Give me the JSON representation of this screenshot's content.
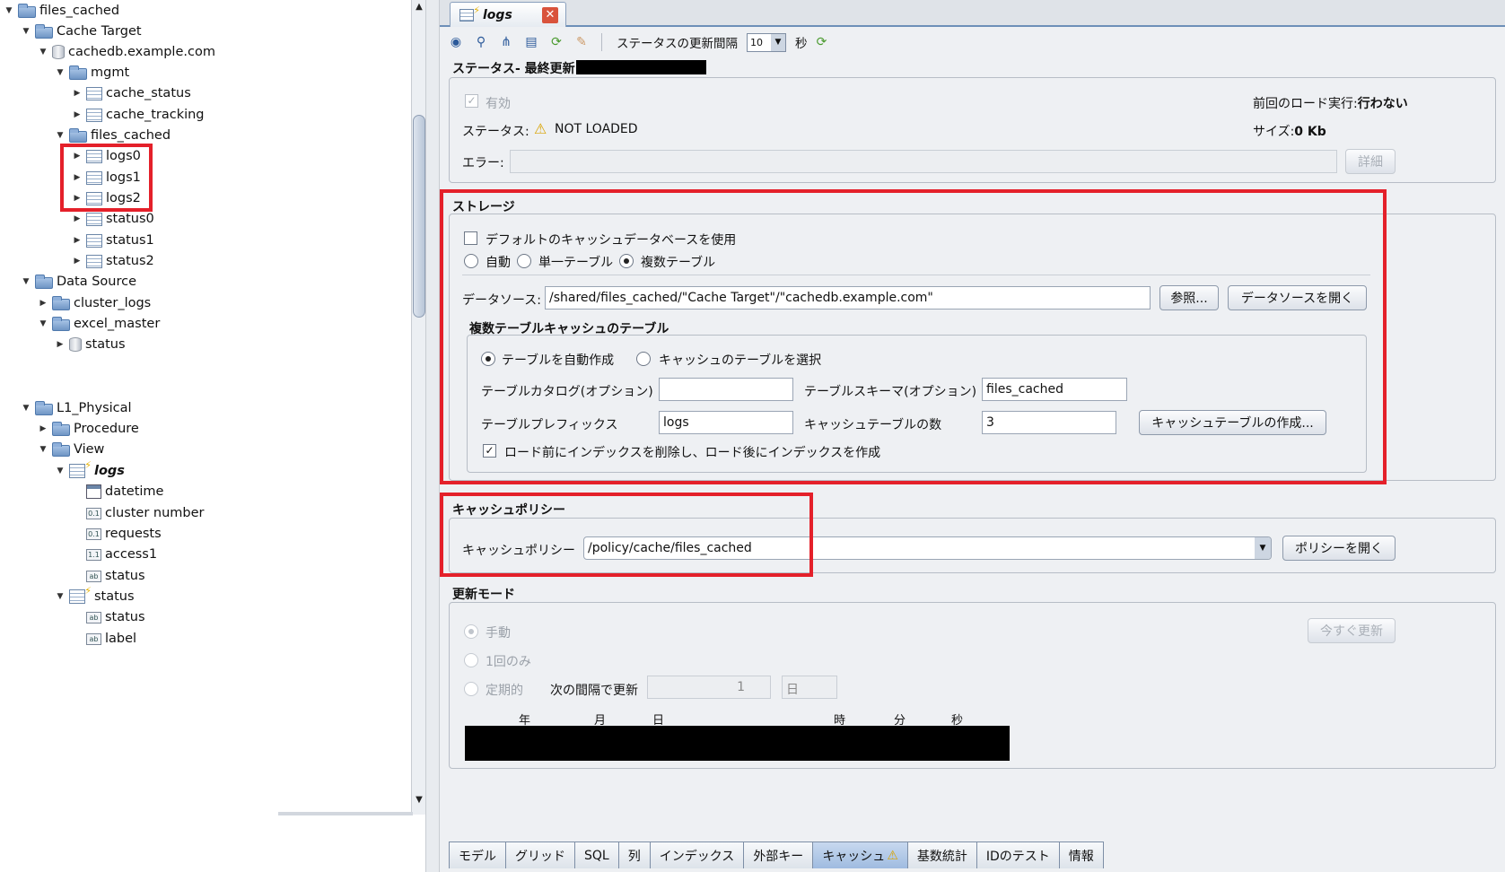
{
  "tree": {
    "items": [
      {
        "label": "files_cached",
        "expanded": true,
        "icon": "folder-icon"
      },
      {
        "label": "Cache Target",
        "expanded": true,
        "icon": "folder-icon"
      },
      {
        "label": "cachedb.example.com",
        "expanded": true,
        "icon": "database-icon"
      },
      {
        "label": "mgmt",
        "expanded": true,
        "icon": "folder-icon"
      },
      {
        "label": "cache_status",
        "expanded": false,
        "icon": "table-icon"
      },
      {
        "label": "cache_tracking",
        "expanded": false,
        "icon": "table-icon"
      },
      {
        "label": "files_cached",
        "expanded": true,
        "icon": "folder-icon"
      },
      {
        "label": "logs0",
        "expanded": false,
        "icon": "table-icon"
      },
      {
        "label": "logs1",
        "expanded": false,
        "icon": "table-icon"
      },
      {
        "label": "logs2",
        "expanded": false,
        "icon": "table-icon"
      },
      {
        "label": "status0",
        "expanded": false,
        "icon": "table-icon"
      },
      {
        "label": "status1",
        "expanded": false,
        "icon": "table-icon"
      },
      {
        "label": "status2",
        "expanded": false,
        "icon": "table-icon"
      },
      {
        "label": "Data Source",
        "expanded": true,
        "icon": "folder-icon"
      },
      {
        "label": "cluster_logs",
        "expanded": false,
        "icon": "folder-icon"
      },
      {
        "label": "excel_master",
        "expanded": true,
        "icon": "folder-icon"
      },
      {
        "label": "status",
        "expanded": false,
        "icon": "database-icon"
      },
      {
        "label": "L1_Physical",
        "expanded": true,
        "icon": "folder-icon"
      },
      {
        "label": "Procedure",
        "expanded": false,
        "icon": "folder-icon"
      },
      {
        "label": "View",
        "expanded": true,
        "icon": "folder-icon"
      },
      {
        "label": "logs",
        "expanded": true,
        "icon": "view-icon"
      },
      {
        "label": "datetime",
        "icon": "calendar-column-icon"
      },
      {
        "label": "cluster number",
        "icon": "column-icon"
      },
      {
        "label": "requests",
        "icon": "column-icon"
      },
      {
        "label": "access1",
        "icon": "column-icon"
      },
      {
        "label": "status",
        "icon": "column-icon"
      },
      {
        "label": "status",
        "expanded": true,
        "icon": "view-icon"
      },
      {
        "label": "status",
        "icon": "column-icon"
      },
      {
        "label": "label",
        "icon": "column-icon"
      }
    ]
  },
  "editor": {
    "tab_title": "logs",
    "tab_close": "✕",
    "toolbar": {
      "refresh_interval_label": "ステータスの更新間隔",
      "refresh_interval_value": "10",
      "unit": "秒"
    },
    "status": {
      "title": "ステータス- 最終更新:",
      "enabled_label": "有効",
      "enabled_checked": "✓",
      "status_label": "ステータス:",
      "status_icon": "⚠",
      "status_value": "NOT LOADED",
      "error_label": "エラー:",
      "error_value": "",
      "detail_button": "詳細",
      "last_load_label": "前回のロード実行:",
      "last_load_value": "行わない",
      "size_label": "サイズ:",
      "size_value": "0 Kb"
    },
    "storage": {
      "title": "ストレージ",
      "use_default_db": "デフォルトのキャッシュデータベースを使用",
      "mode_auto": "自動",
      "mode_single": "単一テーブル",
      "mode_multi": "複数テーブル",
      "selected_mode": "複数テーブル",
      "datasource_label": "データソース:",
      "datasource_value": "/shared/files_cached/\"Cache Target\"/\"cachedb.example.com\"",
      "browse_button": "参照...",
      "open_datasource_button": "データソースを開く",
      "multi_title": "複数テーブルキャッシュのテーブル",
      "auto_create": "テーブルを自動作成",
      "select_tables": "キャッシュのテーブルを選択",
      "catalog_label": "テーブルカタログ(オプション)",
      "catalog_value": "",
      "schema_label": "テーブルスキーマ(オプション)",
      "schema_value": "files_cached",
      "prefix_label": "テーブルプレフィックス",
      "prefix_value": "logs",
      "count_label": "キャッシュテーブルの数",
      "count_value": "3",
      "create_button": "キャッシュテーブルの作成...",
      "drop_index_label": "ロード前にインデックスを削除し、ロード後にインデックスを作成",
      "drop_index_checked": "✓"
    },
    "policy": {
      "title": "キャッシュポリシー",
      "label": "キャッシュポリシー",
      "value": "/policy/cache/files_cached",
      "open_button": "ポリシーを開く"
    },
    "refresh_mode": {
      "title": "更新モード",
      "manual": "手動",
      "once": "1回のみ",
      "periodic": "定期的",
      "interval_label": "次の間隔で更新",
      "interval_value": "1",
      "interval_unit": "日",
      "refresh_now_button": "今すぐ更新",
      "col_year": "年",
      "col_month": "月",
      "col_day": "日",
      "col_hour": "時",
      "col_minute": "分",
      "col_second": "秒"
    },
    "bottom_tabs": [
      "モデル",
      "グリッド",
      "SQL",
      "列",
      "インデックス",
      "外部キー",
      "キャッシュ",
      "基数統計",
      "IDのテスト",
      "情報"
    ],
    "selected_bottom_tab": "キャッシュ",
    "cache_tab_warning_icon": "⚠"
  },
  "colors": {
    "highlight_box": "#e4202a",
    "tab_selected": "#9fbbe0"
  }
}
